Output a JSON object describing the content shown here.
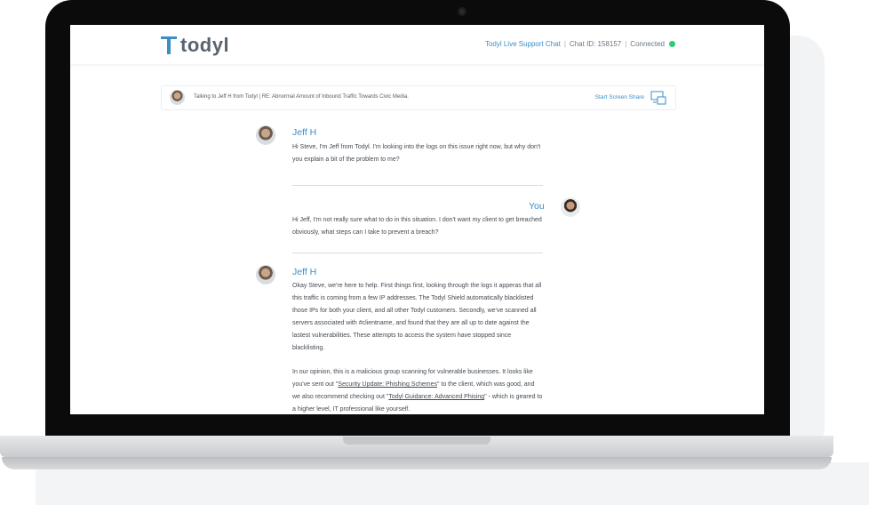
{
  "header": {
    "logo_text": "todyl",
    "live_label": "Todyl Live Support Chat",
    "chat_id": "Chat ID: 158157",
    "connection": "Connected",
    "connection_color": "#2ecc71",
    "accent_color": "#3a8fc8"
  },
  "topic": {
    "text": "Talking to Jeff H from Todyl | RE: Abnormal Amount of Inbound Traffic Towards Civic Media.",
    "share_label": "Start Screen Share",
    "share_icon": "screen-share-icon"
  },
  "messages": [
    {
      "author": "Jeff H",
      "lines": "Hi Steve, I'm Jeff from Todyl. I'm looking into the logs on this issue right now, but why don't you explain a bit of the problem to me?"
    },
    {
      "author": "You",
      "lines": "Hi Jeff, I'm not really sure what to do in this situation. I don't want my client to get breached obviously, what steps can I take to prevent a breach?"
    },
    {
      "author": "Jeff H",
      "para1": "Okay Steve, we're here to help. First things first, looking through the logs it apperas that all this traffic is coming from a few IP addresses. The Todyl Shield automatically blacklisted those IPs for both your client, and all other Todyl customers. Secondly, we've scanned all servers associated with #clientname, and found that they are all up to date against the lastest vulnerabilities. These attempts to access the system have stopped since blacklisting.",
      "para2_a": "In our opinion, this is a malicious group scanning for vulnerable businesses. It looks like you've sent out \"",
      "link1": "Security Update: Phishing Schemes",
      "para2_b": "\" to the client, which was good, and we also recommend checking out \"",
      "link2": "Todyl Guidance: Advanced Phising",
      "para2_c": "\" - which is geared to a higher level, IT professional like yourself."
    }
  ]
}
